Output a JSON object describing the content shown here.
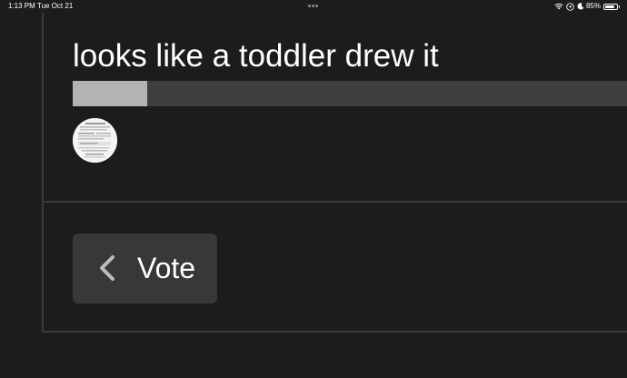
{
  "status_bar": {
    "time": "1:13 PM",
    "date": "Tue Oct 21",
    "battery_percent_label": "85%",
    "battery_level": 0.85,
    "icons": [
      "wifi-icon",
      "location-icon",
      "moon-icon",
      "battery-icon"
    ]
  },
  "poll": {
    "option_text": "looks like a toddler drew it",
    "result_fraction": 0.134,
    "bar_fill_color": "#b3b3b3",
    "bar_track_color": "#3e3e3e"
  },
  "vote_button": {
    "label": "Vote",
    "icon": "chevron-left-icon"
  },
  "colors": {
    "background": "#1c1c1c",
    "divider": "#3a3a3a",
    "button_bg": "#383838",
    "text": "#ffffff"
  }
}
